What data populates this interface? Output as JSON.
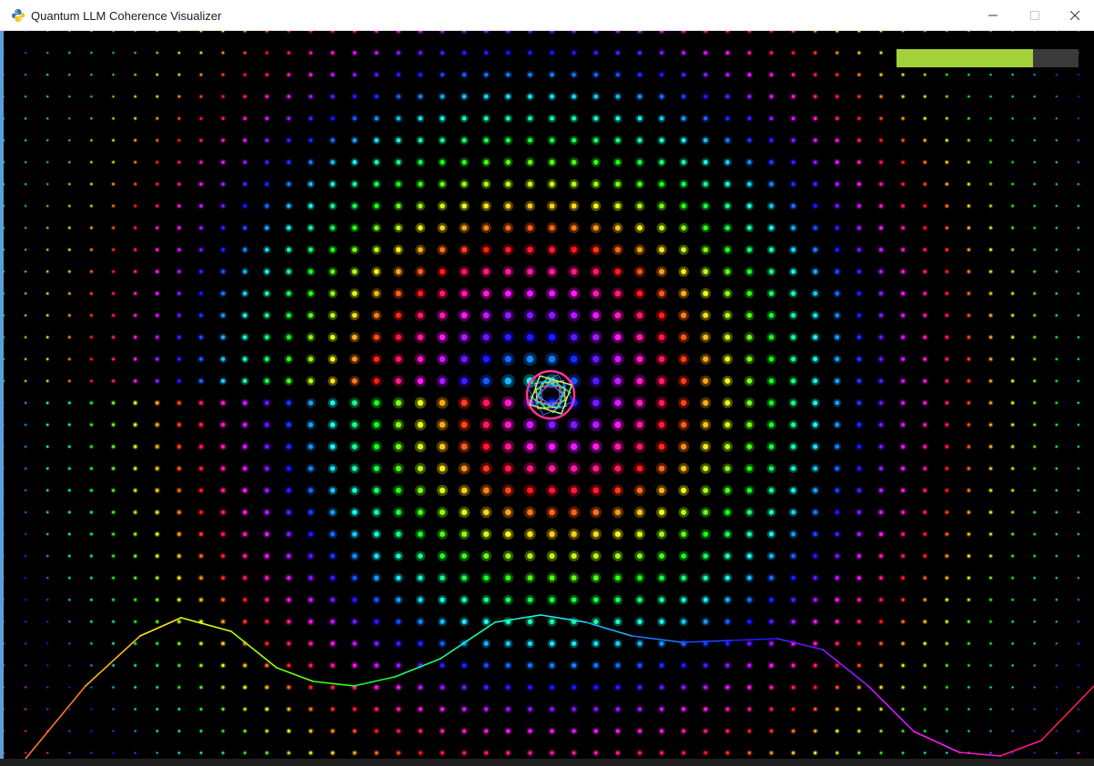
{
  "window": {
    "title": "Quantum LLM Coherence Visualizer",
    "app_icon": "python-snake-icon",
    "controls": {
      "minimize_icon": "minimize-icon",
      "maximize_icon": "maximize-icon",
      "close_icon": "close-icon"
    }
  },
  "visualizer": {
    "background_color": "#000000",
    "coherence_level": 0.75,
    "coherence_bar_fill_color": "#a4d13a",
    "coherence_bar_track_color": "#3a3a3a",
    "particle_grid": {
      "columns": 50,
      "rows": 34,
      "palette": [
        "#ff3300",
        "#ff8800",
        "#ffee00",
        "#55ff00",
        "#00ff66",
        "#00ffee",
        "#0099ff",
        "#1133ff",
        "#8800ff",
        "#ff00cc"
      ]
    },
    "central_entity": {
      "colors": [
        "#ff3399",
        "#33ff66",
        "#ffee33",
        "#3366ff",
        "#00ccff"
      ]
    },
    "wave": {
      "gradient_colors": [
        "#ff5522",
        "#ffee00",
        "#33ff33",
        "#00ccff",
        "#2233ff",
        "#ff22cc",
        "#ff8800"
      ]
    }
  }
}
